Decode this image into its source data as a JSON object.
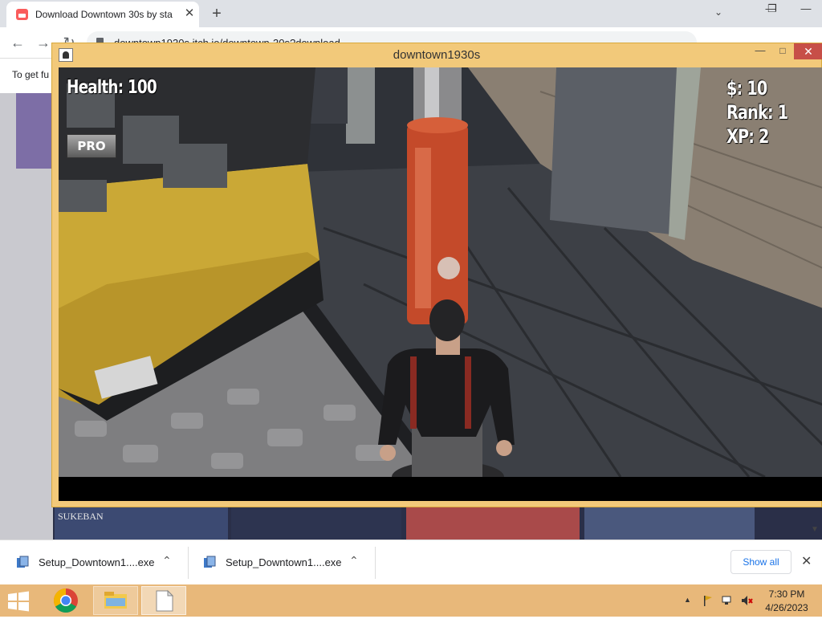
{
  "browser": {
    "tab_title": "Download Downtown 30s by sta",
    "tab_close": "✕",
    "new_tab": "+",
    "tab_search": "⌄",
    "window_min": "—",
    "window_restore": "❐",
    "window_close": "—",
    "back": "←",
    "forward": "→",
    "reload": "↻",
    "url": "downtown1930s.itch.io/downtown-30s?download",
    "page_snippet": "To get fu",
    "thumb_label": "SUKEBAN"
  },
  "game": {
    "window_title": "downtown1930s",
    "minimize": "—",
    "maximize": "□",
    "close": "✕",
    "hud": {
      "health": "Health: 100",
      "money": "$: 10",
      "rank": "Rank: 1",
      "xp": "XP: 2"
    },
    "pro_button": "PRO"
  },
  "downloads": {
    "items": [
      {
        "name": "Setup_Downtown1....exe",
        "caret": "⌃"
      },
      {
        "name": "Setup_Downtown1....exe",
        "caret": "⌃"
      }
    ],
    "show_all": "Show all",
    "close": "✕"
  },
  "taskbar": {
    "time": "7:30 PM",
    "date": "4/26/2023"
  }
}
